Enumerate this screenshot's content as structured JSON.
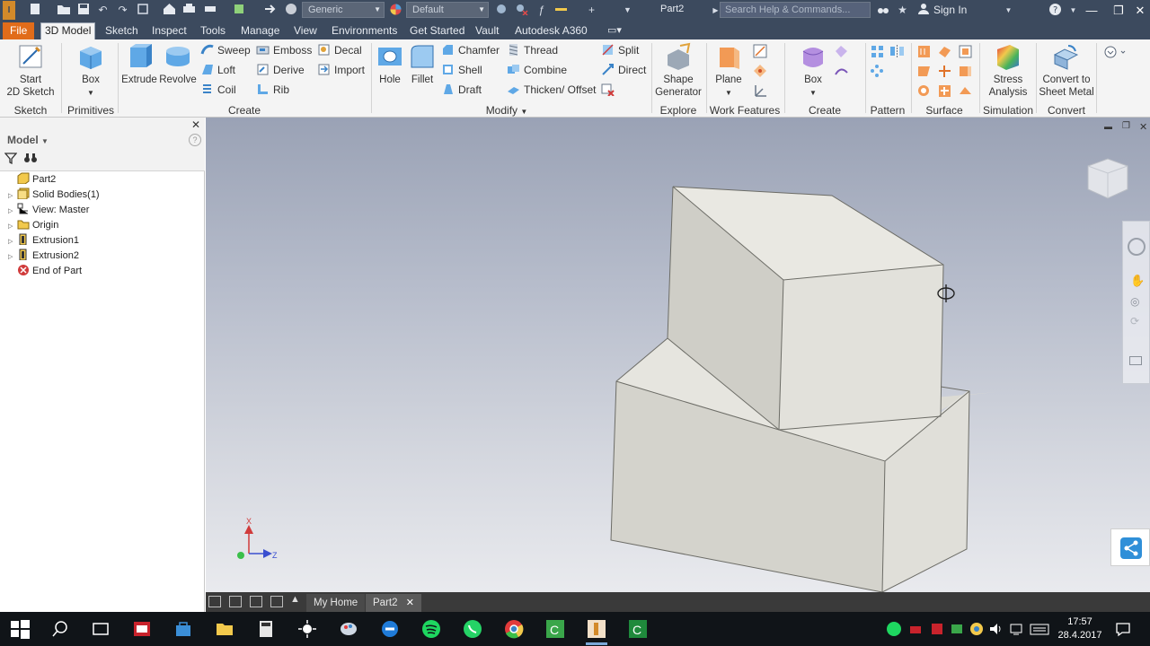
{
  "titlebar": {
    "appearance_combo": "Generic",
    "material_combo": "Default",
    "document_title": "Part2",
    "search_placeholder": "Search Help & Commands...",
    "sign_in": "Sign In"
  },
  "menu_tabs": [
    "File",
    "3D Model",
    "Sketch",
    "Inspect",
    "Tools",
    "Manage",
    "View",
    "Environments",
    "Get Started",
    "Vault",
    "Autodesk A360"
  ],
  "ribbon": {
    "sketch": {
      "title": "Sketch",
      "start_2d_sketch": "Start\n2D Sketch"
    },
    "primitives": {
      "title": "Primitives",
      "box": "Box"
    },
    "create": {
      "title": "Create",
      "extrude": "Extrude",
      "revolve": "Revolve",
      "sweep": "Sweep",
      "loft": "Loft",
      "coil": "Coil",
      "emboss": "Emboss",
      "derive": "Derive",
      "rib": "Rib",
      "decal": "Decal",
      "import": "Import"
    },
    "modify": {
      "title": "Modify",
      "hole": "Hole",
      "fillet": "Fillet",
      "chamfer": "Chamfer",
      "shell": "Shell",
      "draft": "Draft",
      "thread": "Thread",
      "combine": "Combine",
      "thicken_offset": "Thicken/ Offset",
      "split": "Split",
      "direct": "Direct"
    },
    "explore": {
      "title": "Explore",
      "shape_generator": "Shape\nGenerator"
    },
    "work_features": {
      "title": "Work Features",
      "plane": "Plane"
    },
    "create_freeform": {
      "title": "Create Freeform",
      "box": "Box"
    },
    "pattern": {
      "title": "Pattern"
    },
    "surface": {
      "title": "Surface"
    },
    "simulation": {
      "title": "Simulation",
      "stress_analysis": "Stress\nAnalysis"
    },
    "convert": {
      "title": "Convert",
      "convert_to_sheet_metal": "Convert to\nSheet Metal"
    }
  },
  "browser": {
    "title": "Model",
    "tree": [
      {
        "label": "Part2",
        "icon": "part-icon",
        "expandable": false
      },
      {
        "label": "Solid Bodies(1)",
        "icon": "solid-bodies-icon",
        "expandable": true
      },
      {
        "label": "View: Master",
        "icon": "view-icon",
        "expandable": true
      },
      {
        "label": "Origin",
        "icon": "folder-icon",
        "expandable": true
      },
      {
        "label": "Extrusion1",
        "icon": "extrusion-icon",
        "expandable": true
      },
      {
        "label": "Extrusion2",
        "icon": "extrusion-icon",
        "expandable": true
      },
      {
        "label": "End of Part",
        "icon": "end-of-part-icon",
        "expandable": false
      }
    ]
  },
  "viewport": {
    "triad": {
      "x_label": "X",
      "z_label": "Z"
    }
  },
  "doc_tabs": {
    "home": "My Home",
    "active": "Part2"
  },
  "taskbar": {
    "time": "17:57",
    "date": "28.4.2017"
  },
  "colors": {
    "accent_file_tab": "#e16c1a",
    "chrome_dark": "#3c4a5e",
    "ribbon_bg": "#f4f4f4"
  }
}
